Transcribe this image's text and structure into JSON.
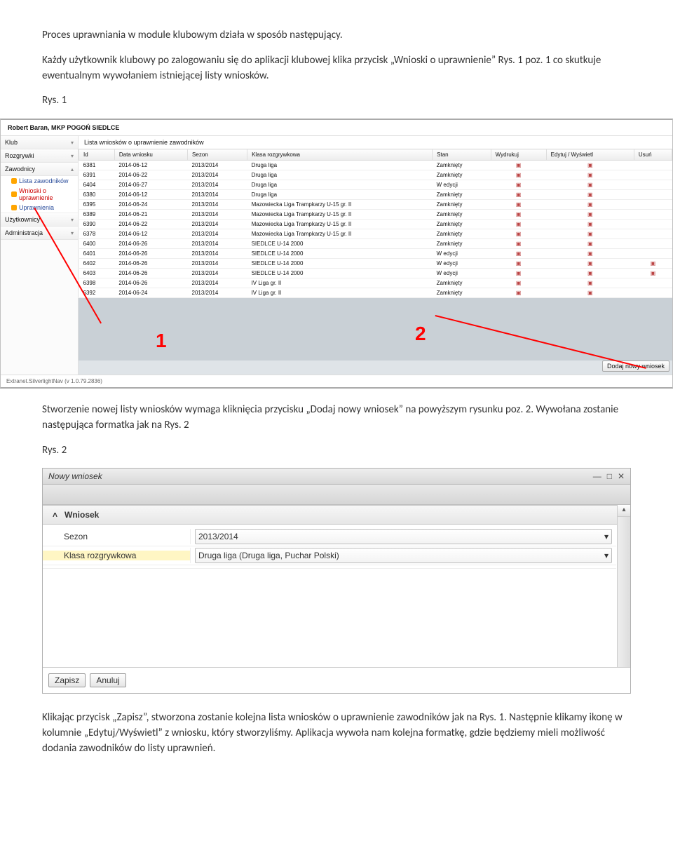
{
  "doc": {
    "p1": "Proces uprawniania w module klubowym działa w sposób następujący.",
    "p2": "Każdy użytkownik klubowy po zalogowaniu się do aplikacji klubowej klika przycisk „Wnioski o uprawnienie” Rys. 1 poz. 1 co skutkuje ewentualnym wywołaniem istniejącej listy wniosków.",
    "rys1": "Rys. 1",
    "p3": "Stworzenie nowej listy wniosków wymaga kliknięcia przycisku „Dodaj nowy wniosek” na powyższym rysunku poz. 2. Wywołana zostanie następująca formatka jak na Rys. 2",
    "rys2": "Rys. 2",
    "p4": "Klikając przycisk „Zapisz”, stworzona zostanie kolejna lista wniosków  o uprawnienie zawodników jak na Rys. 1. Następnie klikamy ikonę w kolumnie „Edytuj/Wyświetl” z wniosku, który stworzyliśmy. Aplikacja wywoła nam kolejna formatkę, gdzie będziemy mieli możliwość dodania zawodników do listy uprawnień."
  },
  "s1": {
    "user": "Robert Baran, MKP POGOŃ SIEDLCE",
    "sidebar": {
      "klub": "Klub",
      "rozgrywki": "Rozgrywki",
      "zawodnicy": "Zawodnicy",
      "sub_lista": "Lista zawodników",
      "sub_wnioski": "Wnioski o uprawnienie",
      "sub_upraw": "Uprawnienia",
      "uzytkownicy": "Użytkownicy",
      "admin": "Administracja"
    },
    "listTitle": "Lista wniosków o uprawnienie zawodników",
    "headers": {
      "id": "Id",
      "data": "Data wniosku",
      "sezon": "Sezon",
      "klasa": "Klasa rozgrywkowa",
      "stan": "Stan",
      "wydrukuj": "Wydrukuj",
      "edytuj": "Edytuj / Wyświetl",
      "usun": "Usuń"
    },
    "rows": [
      {
        "id": "6381",
        "data": "2014-06-12",
        "sezon": "2013/2014",
        "klasa": "Druga liga",
        "stan": "Zamknięty",
        "usun": false
      },
      {
        "id": "6391",
        "data": "2014-06-22",
        "sezon": "2013/2014",
        "klasa": "Druga liga",
        "stan": "Zamknięty",
        "usun": false
      },
      {
        "id": "6404",
        "data": "2014-06-27",
        "sezon": "2013/2014",
        "klasa": "Druga liga",
        "stan": "W edycji",
        "usun": false
      },
      {
        "id": "6380",
        "data": "2014-06-12",
        "sezon": "2013/2014",
        "klasa": "Druga liga",
        "stan": "Zamknięty",
        "usun": false
      },
      {
        "id": "6395",
        "data": "2014-06-24",
        "sezon": "2013/2014",
        "klasa": "Mazowiecka Liga Trampkarzy U-15 gr. II",
        "stan": "Zamknięty",
        "usun": false
      },
      {
        "id": "6389",
        "data": "2014-06-21",
        "sezon": "2013/2014",
        "klasa": "Mazowiecka Liga Trampkarzy U-15 gr. II",
        "stan": "Zamknięty",
        "usun": false
      },
      {
        "id": "6390",
        "data": "2014-06-22",
        "sezon": "2013/2014",
        "klasa": "Mazowiecka Liga Trampkarzy U-15 gr. II",
        "stan": "Zamknięty",
        "usun": false
      },
      {
        "id": "6378",
        "data": "2014-06-12",
        "sezon": "2013/2014",
        "klasa": "Mazowiecka Liga Trampkarzy U-15 gr. II",
        "stan": "Zamknięty",
        "usun": false
      },
      {
        "id": "6400",
        "data": "2014-06-26",
        "sezon": "2013/2014",
        "klasa": "SIEDLCE U-14 2000",
        "stan": "Zamknięty",
        "usun": false
      },
      {
        "id": "6401",
        "data": "2014-06-26",
        "sezon": "2013/2014",
        "klasa": "SIEDLCE U-14 2000",
        "stan": "W edycji",
        "usun": false
      },
      {
        "id": "6402",
        "data": "2014-06-26",
        "sezon": "2013/2014",
        "klasa": "SIEDLCE U-14 2000",
        "stan": "W edycji",
        "usun": true
      },
      {
        "id": "6403",
        "data": "2014-06-26",
        "sezon": "2013/2014",
        "klasa": "SIEDLCE U-14 2000",
        "stan": "W edycji",
        "usun": true
      },
      {
        "id": "6398",
        "data": "2014-06-26",
        "sezon": "2013/2014",
        "klasa": "IV Liga gr. II",
        "stan": "Zamknięty",
        "usun": false
      },
      {
        "id": "6392",
        "data": "2014-06-24",
        "sezon": "2013/2014",
        "klasa": "IV Liga gr. II",
        "stan": "Zamknięty",
        "usun": false
      }
    ],
    "newBtn": "Dodaj nowy wniosek",
    "copyright": "Extranet.SilverlightNav (v 1.0.79.2836)",
    "annot1": "1",
    "annot2": "2"
  },
  "s2": {
    "title": "Nowy wniosek",
    "sectionHead": "Wniosek",
    "row1_label": "Sezon",
    "row1_value": "2013/2014",
    "row2_label": "Klasa rozgrywkowa",
    "row2_value": "Druga liga (Druga liga, Puchar Polski)",
    "zapisz": "Zapisz",
    "anuluj": "Anuluj"
  }
}
